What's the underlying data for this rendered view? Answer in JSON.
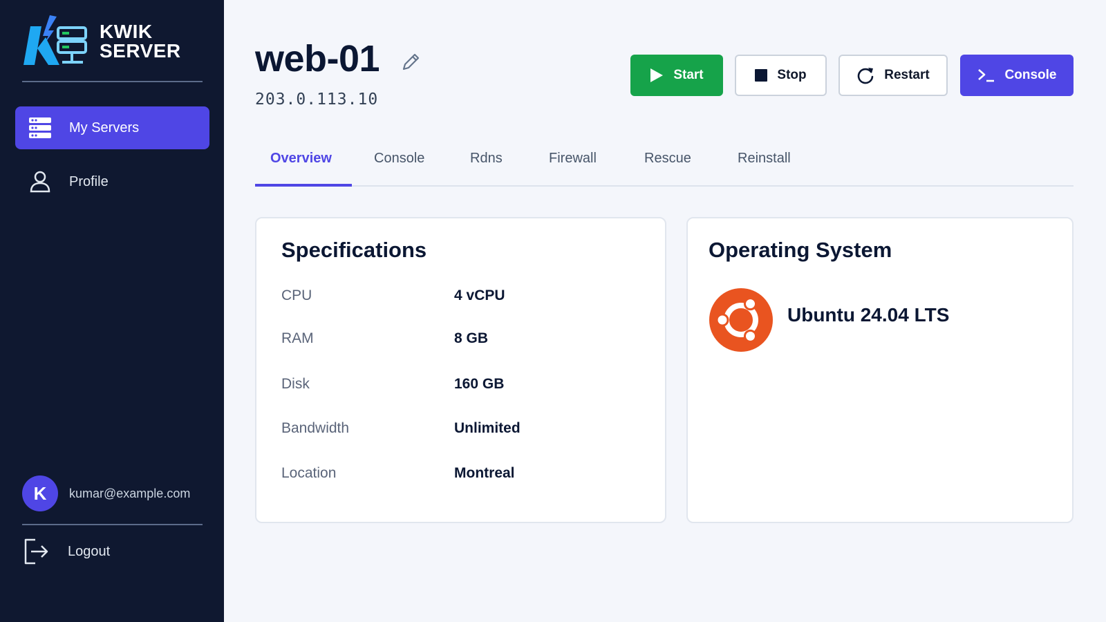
{
  "brand": {
    "line1": "KWIK",
    "line2": "SERVER"
  },
  "sidebar": {
    "items": [
      {
        "label": "My Servers",
        "icon": "server-icon",
        "active": true
      },
      {
        "label": "Profile",
        "icon": "user-icon",
        "active": false
      }
    ],
    "user": {
      "initial": "K",
      "email": "kumar@example.com"
    },
    "logout_label": "Logout"
  },
  "server": {
    "name": "web-01",
    "ip": "203.0.113.10"
  },
  "actions": {
    "start": "Start",
    "stop": "Stop",
    "restart": "Restart",
    "console": "Console"
  },
  "tabs": [
    {
      "label": "Overview",
      "active": true
    },
    {
      "label": "Console"
    },
    {
      "label": "Rdns"
    },
    {
      "label": "Firewall"
    },
    {
      "label": "Rescue"
    },
    {
      "label": "Reinstall"
    }
  ],
  "specifications": {
    "title": "Specifications",
    "rows": [
      {
        "label": "CPU",
        "value": "4 vCPU"
      },
      {
        "label": "RAM",
        "value": "8 GB"
      },
      {
        "label": "Disk",
        "value": "160 GB"
      },
      {
        "label": "Bandwidth",
        "value": "Unlimited"
      },
      {
        "label": "Location",
        "value": "Montreal"
      }
    ]
  },
  "operating_system": {
    "title": "Operating System",
    "name": "Ubuntu 24.04 LTS",
    "icon": "ubuntu-logo-icon"
  },
  "colors": {
    "sidebar_bg": "#0f1830",
    "accent": "#4f46e5",
    "start_green": "#16a34a",
    "ubuntu_orange": "#e95420"
  }
}
